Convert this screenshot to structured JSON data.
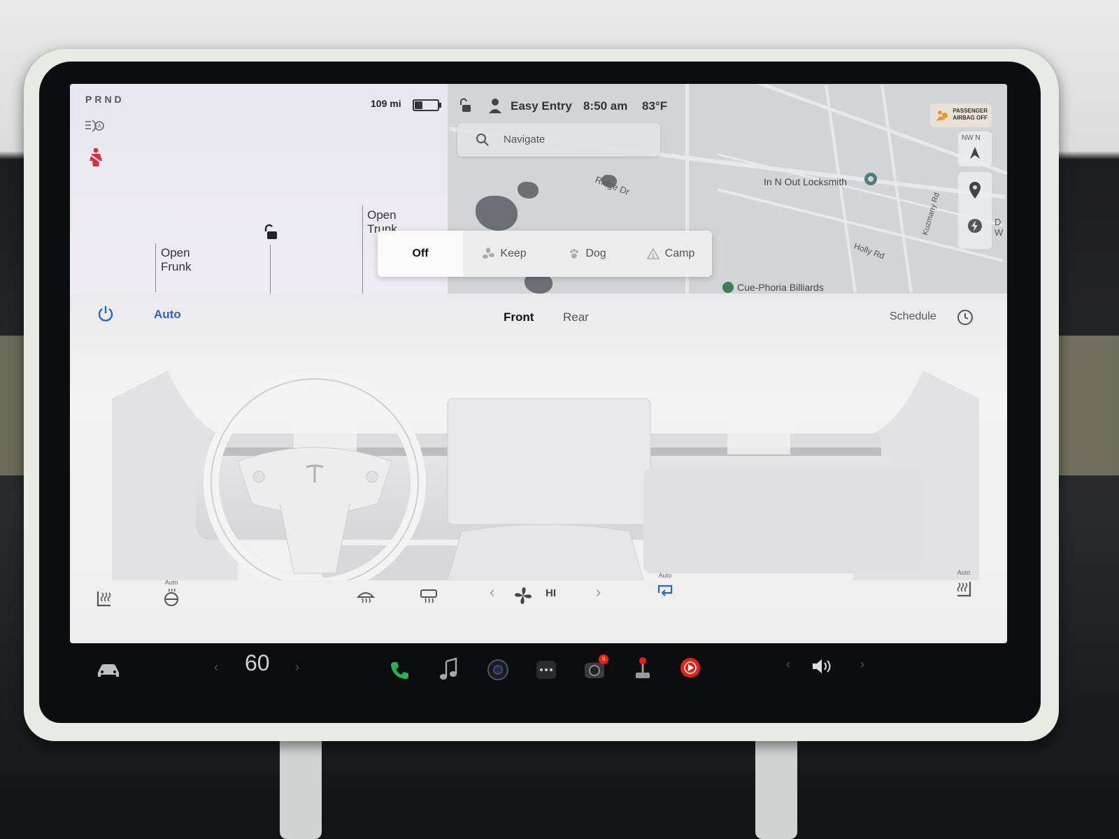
{
  "car": {
    "gear": "PRND",
    "range": "109 mi",
    "battery_level_pct": 35,
    "open_frunk": "Open\nFrunk",
    "open_trunk": "Open\nTrunk"
  },
  "status_bar": {
    "profile": "Easy Entry",
    "time": "8:50 am",
    "temperature": "83°F",
    "airbag_line1": "PASSENGER",
    "airbag_line2": "AIRBAG OFF"
  },
  "map": {
    "search_placeholder": "Navigate",
    "compass_label": "NW  N",
    "street_labels": [
      "Ridge Dr",
      "Kuzmany Rd",
      "Holly Rd"
    ],
    "pois": [
      "In N Out Locksmith",
      "Cue-Phoria Billiards"
    ],
    "edge_label": "D W"
  },
  "cabin_modes": {
    "selected": "Off",
    "options": [
      "Off",
      "Keep",
      "Dog",
      "Camp"
    ]
  },
  "climate": {
    "auto_label": "Auto",
    "tabs": [
      "Front",
      "Rear"
    ],
    "active_tab": "Front",
    "schedule_label": "Schedule",
    "fan_speed": "HI",
    "steering_heat_auto": "Auto",
    "recirc_auto": "Auto",
    "seat_right_auto": "Auto"
  },
  "taskbar": {
    "speed_limit": "60",
    "camera_badge": "II"
  },
  "colors": {
    "accent_blue": "#2a62d8",
    "phone_green": "#2bb24c",
    "youtube_red": "#e62117",
    "seatbelt_red": "#d9303d"
  }
}
